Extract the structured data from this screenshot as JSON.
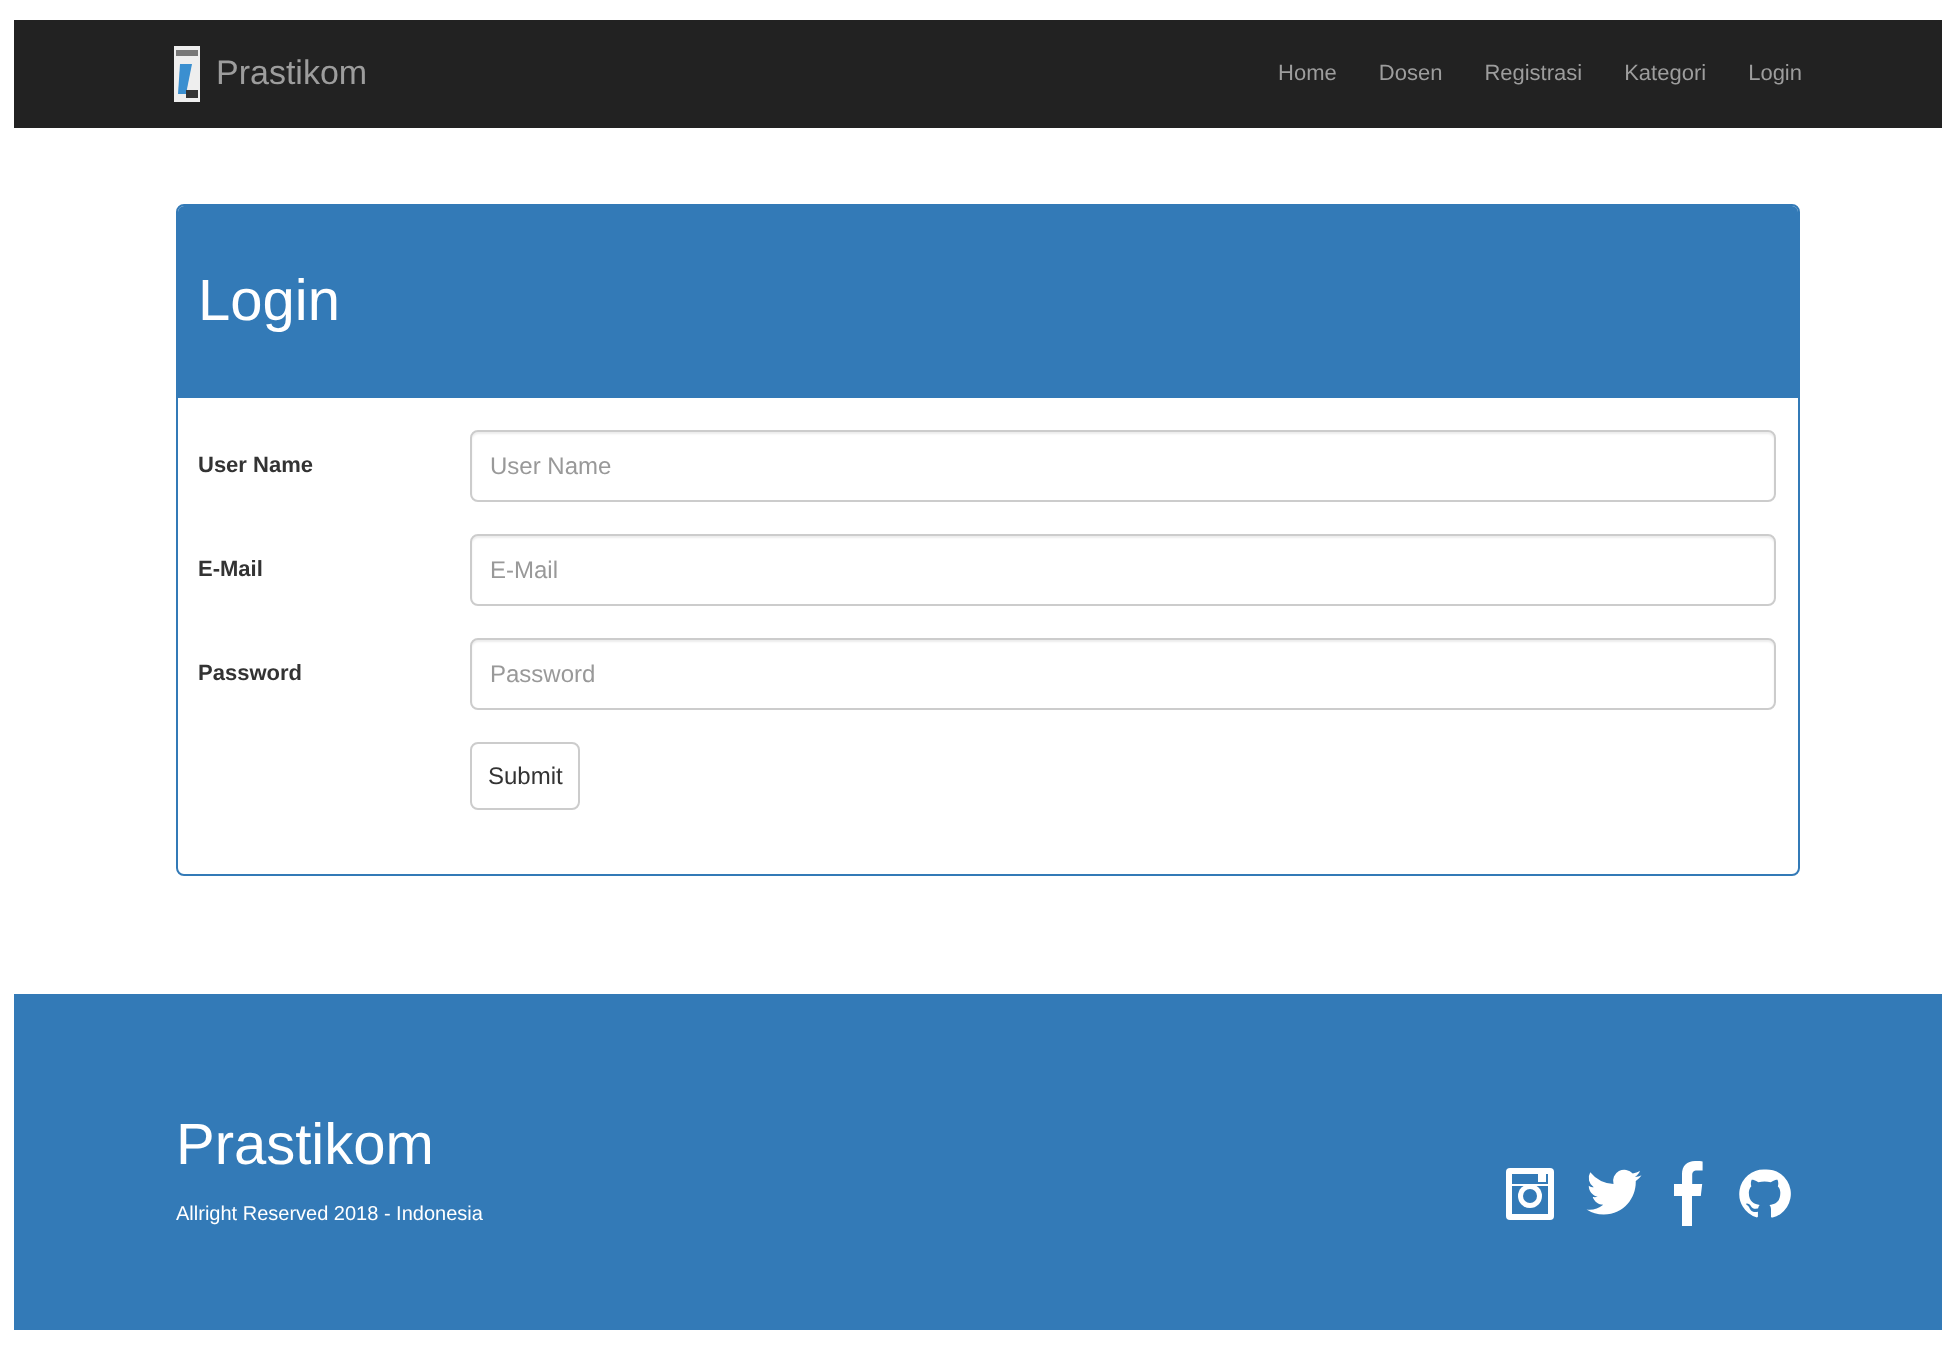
{
  "navbar": {
    "brand": "Prastikom",
    "links": [
      "Home",
      "Dosen",
      "Registrasi",
      "Kategori",
      "Login"
    ]
  },
  "login_panel": {
    "title": "Login",
    "fields": [
      {
        "label": "User Name",
        "placeholder": "User Name"
      },
      {
        "label": "E-Mail",
        "placeholder": "E-Mail"
      },
      {
        "label": "Password",
        "placeholder": "Password"
      }
    ],
    "submit": "Submit"
  },
  "footer": {
    "title": "Prastikom",
    "text": "Allright Reserved 2018 - Indonesia",
    "social": [
      {
        "kind": "instagram"
      },
      {
        "kind": "twitter"
      },
      {
        "kind": "facebook"
      },
      {
        "kind": "github"
      }
    ]
  }
}
